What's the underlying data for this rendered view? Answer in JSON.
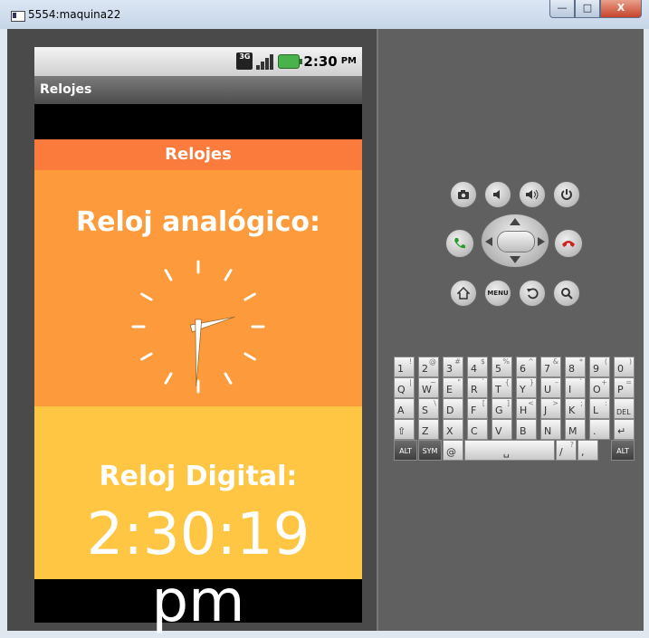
{
  "window": {
    "title": "5554:maquina22",
    "minimize": "—",
    "maximize": "□",
    "close": "X"
  },
  "status_bar": {
    "network": "3G",
    "time": "2:30",
    "ampm": "PM"
  },
  "app": {
    "action_bar_title": "Relojes",
    "header": "Relojes",
    "analog_label": "Reloj analógico:",
    "analog_time": {
      "hour": 2,
      "minute": 30,
      "second": 19
    },
    "digital_label": "Reloj Digital:",
    "digital_time": "2:30:19 pm"
  },
  "colors": {
    "header": "#fa7b3c",
    "analog_bg": "#fd9b3c",
    "digital_bg": "#fec642"
  },
  "controls": {
    "camera": "camera-icon",
    "vol_down": "volume-down-icon",
    "vol_up": "volume-up-icon",
    "power": "power-icon",
    "call": "call-icon",
    "end_call": "end-call-icon",
    "home": "home-icon",
    "menu": "MENU",
    "back": "back-icon",
    "search": "search-icon"
  },
  "keyboard": {
    "row1": [
      {
        "m": "1",
        "s": "!"
      },
      {
        "m": "2",
        "s": "@"
      },
      {
        "m": "3",
        "s": "#"
      },
      {
        "m": "4",
        "s": "$"
      },
      {
        "m": "5",
        "s": "%"
      },
      {
        "m": "6",
        "s": "^"
      },
      {
        "m": "7",
        "s": "&"
      },
      {
        "m": "8",
        "s": "*"
      },
      {
        "m": "9",
        "s": "("
      },
      {
        "m": "0",
        "s": ")"
      }
    ],
    "row2": [
      {
        "m": "Q",
        "s": "|"
      },
      {
        "m": "W",
        "s": "~"
      },
      {
        "m": "E",
        "s": "\""
      },
      {
        "m": "R",
        "s": "`"
      },
      {
        "m": "T",
        "s": "{"
      },
      {
        "m": "Y",
        "s": "}"
      },
      {
        "m": "U",
        "s": "–"
      },
      {
        "m": "I",
        "s": "`"
      },
      {
        "m": "O",
        "s": "+"
      },
      {
        "m": "P",
        "s": "="
      }
    ],
    "row3": [
      {
        "m": "A",
        "s": ""
      },
      {
        "m": "S",
        "s": "\\"
      },
      {
        "m": "D",
        "s": ""
      },
      {
        "m": "F",
        "s": "["
      },
      {
        "m": "G",
        "s": "]"
      },
      {
        "m": "H",
        "s": "<"
      },
      {
        "m": "J",
        "s": ">"
      },
      {
        "m": "K",
        "s": ";"
      },
      {
        "m": "L",
        "s": ":"
      },
      {
        "m": "DEL",
        "s": ""
      }
    ],
    "row4": [
      {
        "m": "⇧",
        "s": ""
      },
      {
        "m": "Z",
        "s": ""
      },
      {
        "m": "X",
        "s": ""
      },
      {
        "m": "C",
        "s": ""
      },
      {
        "m": "V",
        "s": ""
      },
      {
        "m": "B",
        "s": ""
      },
      {
        "m": "N",
        "s": ""
      },
      {
        "m": "M",
        "s": ""
      },
      {
        "m": ".",
        "s": ""
      },
      {
        "m": "↵",
        "s": ""
      }
    ],
    "row5": {
      "alt": "ALT",
      "sym": "SYM",
      "at": "@",
      "space": "␣",
      "slash": "/",
      "slash_s": "?",
      "comma": ",",
      "alt2": "ALT"
    }
  }
}
